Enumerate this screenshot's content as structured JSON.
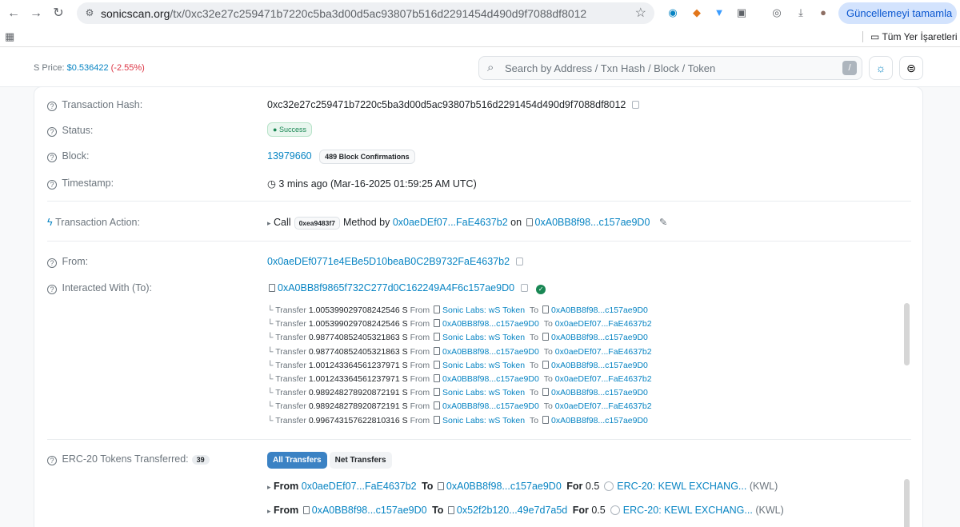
{
  "browser": {
    "url_host": "sonicscan.org",
    "url_path": "/tx/0xc32e27c259471b7220c5ba3d00d5ac93807b516d2291454d490d9f7088df8012",
    "update_button": "Güncellemeyi tamamla",
    "bookmarks_all": "Tüm Yer İşaretleri"
  },
  "header": {
    "price_label": "S Price:",
    "price_value": "$0.536422",
    "price_change": "(-2.55%)",
    "search_placeholder": "Search by Address / Txn Hash / Block / Token",
    "search_shortcut": "/"
  },
  "tx": {
    "hash_label": "Transaction Hash:",
    "hash": "0xc32e27c259471b7220c5ba3d00d5ac93807b516d2291454d490d9f7088df8012",
    "status_label": "Status:",
    "status": "Success",
    "block_label": "Block:",
    "block": "13979660",
    "confirmations": "489 Block Confirmations",
    "timestamp_label": "Timestamp:",
    "timestamp": "3 mins ago (Mar-16-2025 01:59:25 AM UTC)",
    "action_label": "Transaction Action:",
    "action_call": "Call",
    "action_method_id": "0xea9483f7",
    "action_method_by": "Method by",
    "action_by": "0x0aeDEf07...FaE4637b2",
    "action_on": "on",
    "action_contract": "0xA0BB8f98...c157ae9D0",
    "from_label": "From:",
    "from": "0x0aeDEf0771e4EBe5D10beaB0C2B9732FaE4637b2",
    "to_label": "Interacted With (To):",
    "to": "0xA0BB8f9865f732C277d0C162249A4F6c157ae9D0"
  },
  "transfers": [
    {
      "label": "Transfer",
      "amount": "1.005399029708242546",
      "unit": "S",
      "from_word": "From",
      "from": "Sonic Labs: wS Token",
      "to_word": "To",
      "to": "0xA0BB8f98...c157ae9D0"
    },
    {
      "label": "Transfer",
      "amount": "1.005399029708242546",
      "unit": "S",
      "from_word": "From",
      "from": "0xA0BB8f98...c157ae9D0",
      "to_word": "To",
      "to": "0x0aeDEf07...FaE4637b2"
    },
    {
      "label": "Transfer",
      "amount": "0.987740852405321863",
      "unit": "S",
      "from_word": "From",
      "from": "Sonic Labs: wS Token",
      "to_word": "To",
      "to": "0xA0BB8f98...c157ae9D0"
    },
    {
      "label": "Transfer",
      "amount": "0.987740852405321863",
      "unit": "S",
      "from_word": "From",
      "from": "0xA0BB8f98...c157ae9D0",
      "to_word": "To",
      "to": "0x0aeDEf07...FaE4637b2"
    },
    {
      "label": "Transfer",
      "amount": "1.001243364561237971",
      "unit": "S",
      "from_word": "From",
      "from": "Sonic Labs: wS Token",
      "to_word": "To",
      "to": "0xA0BB8f98...c157ae9D0"
    },
    {
      "label": "Transfer",
      "amount": "1.001243364561237971",
      "unit": "S",
      "from_word": "From",
      "from": "0xA0BB8f98...c157ae9D0",
      "to_word": "To",
      "to": "0x0aeDEf07...FaE4637b2"
    },
    {
      "label": "Transfer",
      "amount": "0.989248278920872191",
      "unit": "S",
      "from_word": "From",
      "from": "Sonic Labs: wS Token",
      "to_word": "To",
      "to": "0xA0BB8f98...c157ae9D0"
    },
    {
      "label": "Transfer",
      "amount": "0.989248278920872191",
      "unit": "S",
      "from_word": "From",
      "from": "0xA0BB8f98...c157ae9D0",
      "to_word": "To",
      "to": "0x0aeDEf07...FaE4637b2"
    },
    {
      "label": "Transfer",
      "amount": "0.996743157622810316",
      "unit": "S",
      "from_word": "From",
      "from": "Sonic Labs: wS Token",
      "to_word": "To",
      "to": "0xA0BB8f98...c157ae9D0"
    }
  ],
  "erc20": {
    "label": "ERC-20 Tokens Transferred:",
    "count": "39",
    "tab_all": "All Transfers",
    "tab_net": "Net Transfers",
    "rows": [
      {
        "from_word": "From",
        "from": "0x0aeDEf07...FaE4637b2",
        "to_word": "To",
        "to": "0xA0BB8f98...c157ae9D0",
        "for_word": "For",
        "amount": "0.5",
        "token": "ERC-20: KEWL EXCHANG...",
        "symbol": "(KWL)"
      },
      {
        "from_word": "From",
        "from": "0xA0BB8f98...c157ae9D0",
        "to_word": "To",
        "to": "0x52f2b120...49e7d7a5d",
        "for_word": "For",
        "amount": "0.5",
        "token": "ERC-20: KEWL EXCHANG...",
        "symbol": "(KWL)"
      }
    ]
  }
}
